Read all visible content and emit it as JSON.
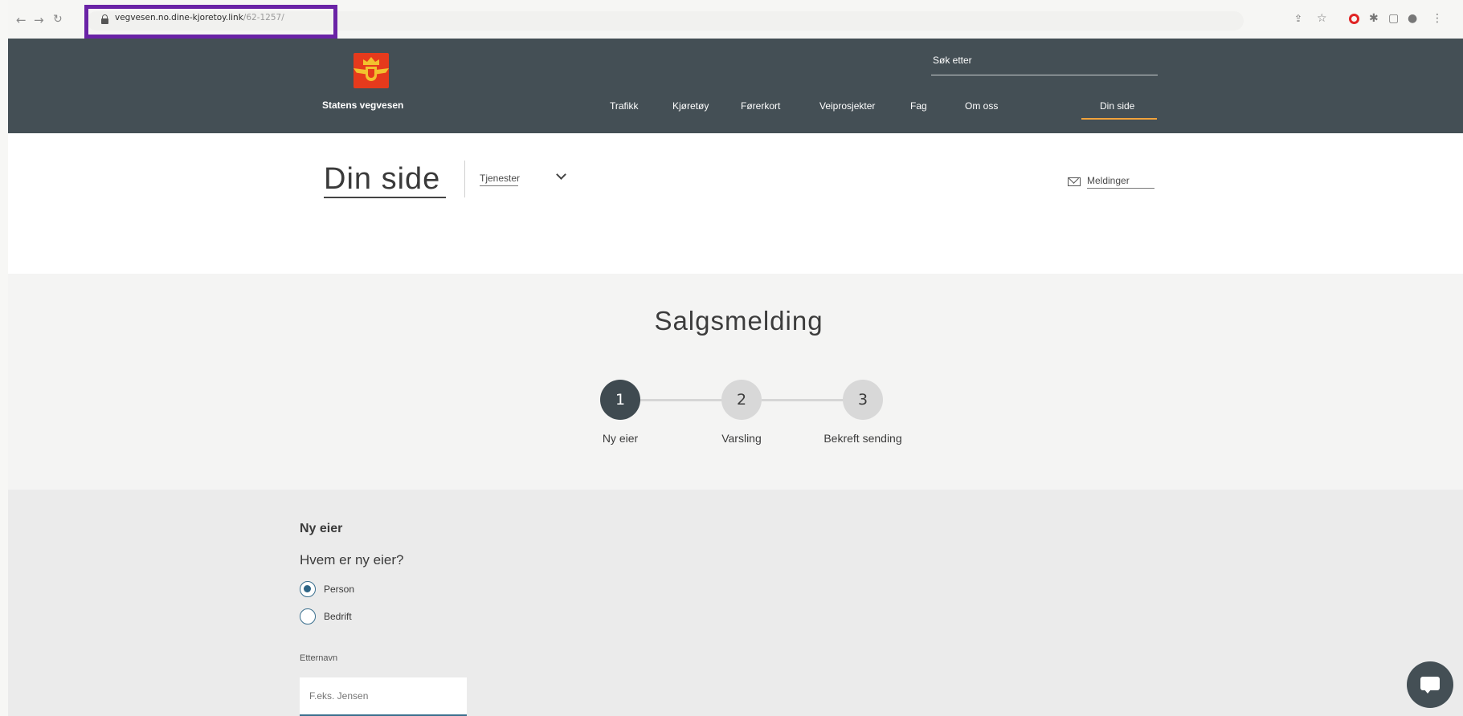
{
  "browser": {
    "url_main": "vegvesen.no.dine-kjoretoy.link",
    "url_rest": "/62-1257/",
    "icons": [
      "back-arrow-icon",
      "forward-arrow-icon",
      "reload-icon",
      "lock-icon",
      "share-icon",
      "star-icon",
      "opera-icon",
      "extensions-icon",
      "sidebar-icon",
      "profile-icon",
      "menu-icon"
    ]
  },
  "header": {
    "logo_text": "Statens vegvesen",
    "search_label": "Søk etter",
    "menu": [
      "Trafikk",
      "Kjøretøy",
      "Førerkort",
      "Veiprosjekter",
      "Fag",
      "Om oss",
      "Din side"
    ],
    "active_menu": "Din side",
    "accent_color": "#f0a23b",
    "background_color": "#444f55"
  },
  "subheader": {
    "title": "Din side",
    "services": "Tjenester",
    "messages": "Meldinger"
  },
  "stepper": {
    "title": "Salgsmelding",
    "steps": [
      {
        "number": "1",
        "label": "Ny eier",
        "state": "active"
      },
      {
        "number": "2",
        "label": "Varsling",
        "state": "idle"
      },
      {
        "number": "3",
        "label": "Bekreft sending",
        "state": "idle"
      }
    ]
  },
  "form": {
    "heading": "Ny eier",
    "question": "Hvem er ny eier?",
    "options": [
      {
        "label": "Person",
        "checked": true
      },
      {
        "label": "Bedrift",
        "checked": false
      }
    ],
    "field_label": "Etternavn",
    "field_placeholder": "F.eks. Jensen",
    "field_value": ""
  },
  "chat": {
    "icon": "chat-icon"
  }
}
